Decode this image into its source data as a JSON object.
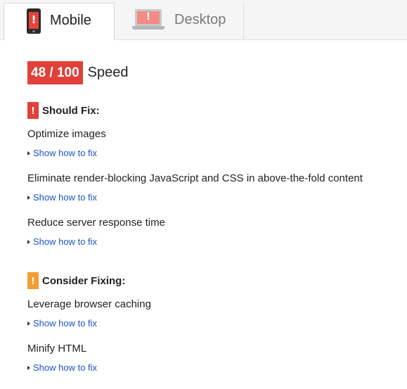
{
  "tabs": [
    {
      "label": "Mobile",
      "icon": "phone-icon",
      "active": true
    },
    {
      "label": "Desktop",
      "icon": "laptop-icon",
      "active": false
    }
  ],
  "score": {
    "value": "48 / 100",
    "label": "Speed",
    "color": "#e0413a"
  },
  "sections": [
    {
      "title": "Should Fix:",
      "icon": "exclamation-icon",
      "color": "#e0413a",
      "rules": [
        {
          "title": "Optimize images",
          "link": "Show how to fix"
        },
        {
          "title": "Eliminate render-blocking JavaScript and CSS in above-the-fold content",
          "link": "Show how to fix"
        },
        {
          "title": "Reduce server response time",
          "link": "Show how to fix"
        }
      ]
    },
    {
      "title": "Consider Fixing:",
      "icon": "exclamation-icon",
      "color": "#f39c33",
      "rules": [
        {
          "title": "Leverage browser caching",
          "link": "Show how to fix"
        },
        {
          "title": "Minify HTML",
          "link": "Show how to fix"
        }
      ]
    }
  ],
  "link_color": "#1a55c5"
}
